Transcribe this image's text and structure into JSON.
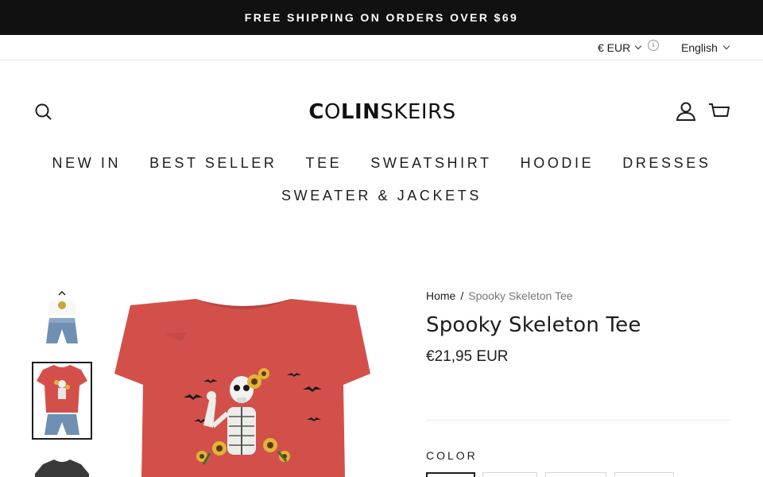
{
  "announcement": {
    "text": "FREE SHIPPING ON ORDERS OVER $69"
  },
  "utility": {
    "currency": "€ EUR",
    "info_glyph": "i",
    "language": "English"
  },
  "header": {
    "logo_bold_1": "C",
    "logo_light_1": "O",
    "logo_bold_2": "LIN",
    "logo_light_2": "SKEIRS",
    "icons": [
      "search-icon",
      "account-icon",
      "cart-icon"
    ]
  },
  "nav": {
    "items": [
      {
        "label": "NEW IN"
      },
      {
        "label": "BEST SELLER"
      },
      {
        "label": "TEE"
      },
      {
        "label": "SWEATSHIRT"
      },
      {
        "label": "HOODIE"
      },
      {
        "label": "DRESSES"
      },
      {
        "label": "SWEATER & JACKETS"
      }
    ]
  },
  "product": {
    "breadcrumb": {
      "home": "Home",
      "separator": "/",
      "current": "Spooky Skeleton Tee"
    },
    "title": "Spooky Skeleton Tee",
    "price": "€21,95 EUR",
    "color_label": "COLOR",
    "shirt_color": "#d3504a",
    "thumb_colors": [
      "#ffffff",
      "#d3504a",
      "#3a3a3a"
    ]
  }
}
